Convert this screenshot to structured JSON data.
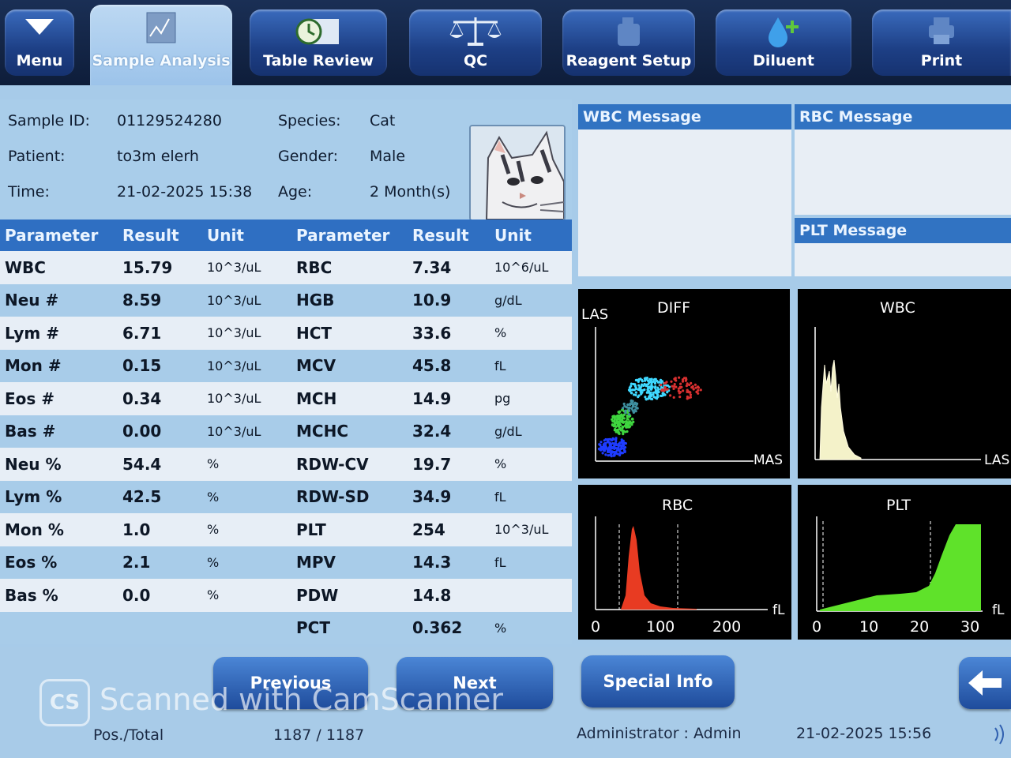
{
  "toolbar": {
    "menu": "Menu",
    "sample_analysis": "Sample Analysis",
    "table_review": "Table Review",
    "qc": "QC",
    "reagent_setup": "Reagent Setup",
    "diluent": "Diluent",
    "print": "Print"
  },
  "sample": {
    "sample_id_label": "Sample ID:",
    "sample_id": "01129524280",
    "patient_label": "Patient:",
    "patient": "to3m elerh",
    "time_label": "Time:",
    "time": "21-02-2025 15:38",
    "species_label": "Species:",
    "species": "Cat",
    "gender_label": "Gender:",
    "gender": "Male",
    "age_label": "Age:",
    "age": "2 Month(s)"
  },
  "results": {
    "headers": [
      "Parameter",
      "Result",
      "Unit",
      "Parameter",
      "Result",
      "Unit"
    ],
    "rows": [
      [
        "WBC",
        "15.79",
        "10^3/uL",
        "RBC",
        "7.34",
        "10^6/uL"
      ],
      [
        "Neu #",
        "8.59",
        "10^3/uL",
        "HGB",
        "10.9",
        "g/dL"
      ],
      [
        "Lym #",
        "6.71",
        "10^3/uL",
        "HCT",
        "33.6",
        "%"
      ],
      [
        "Mon #",
        "0.15",
        "10^3/uL",
        "MCV",
        "45.8",
        "fL"
      ],
      [
        "Eos #",
        "0.34",
        "10^3/uL",
        "MCH",
        "14.9",
        "pg"
      ],
      [
        "Bas #",
        "0.00",
        "10^3/uL",
        "MCHC",
        "32.4",
        "g/dL"
      ],
      [
        "Neu %",
        "54.4",
        "%",
        "RDW-CV",
        "19.7",
        "%"
      ],
      [
        "Lym %",
        "42.5",
        "%",
        "RDW-SD",
        "34.9",
        "fL"
      ],
      [
        "Mon %",
        "1.0",
        "%",
        "PLT",
        "254",
        "10^3/uL"
      ],
      [
        "Eos %",
        "2.1",
        "%",
        "MPV",
        "14.3",
        "fL"
      ],
      [
        "Bas %",
        "0.0",
        "%",
        "PDW",
        "14.8",
        ""
      ],
      [
        "",
        "",
        "",
        "PCT",
        "0.362",
        "%"
      ]
    ]
  },
  "messages": {
    "wbc": "WBC Message",
    "rbc": "RBC Message",
    "plt": "PLT Message"
  },
  "plots": {
    "diff": {
      "title": "DIFF",
      "y_label": "LAS",
      "x_label": "MAS"
    },
    "wbc": {
      "title": "WBC",
      "x_label": "LAS"
    },
    "rbc": {
      "title": "RBC",
      "unit": "fL",
      "ticks": [
        "0",
        "100",
        "200"
      ]
    },
    "plt": {
      "title": "PLT",
      "unit": "fL",
      "ticks": [
        "0",
        "10",
        "20",
        "30"
      ]
    }
  },
  "buttons": {
    "previous": "Previous",
    "next": "Next",
    "special_info": "Special Info"
  },
  "status": {
    "pos_label": "Pos./Total",
    "pos_value": "1187 / 1187",
    "user": "Administrator : Admin",
    "datetime": "21-02-2025 15:56"
  },
  "watermark": "Scanned with CamScanner"
}
